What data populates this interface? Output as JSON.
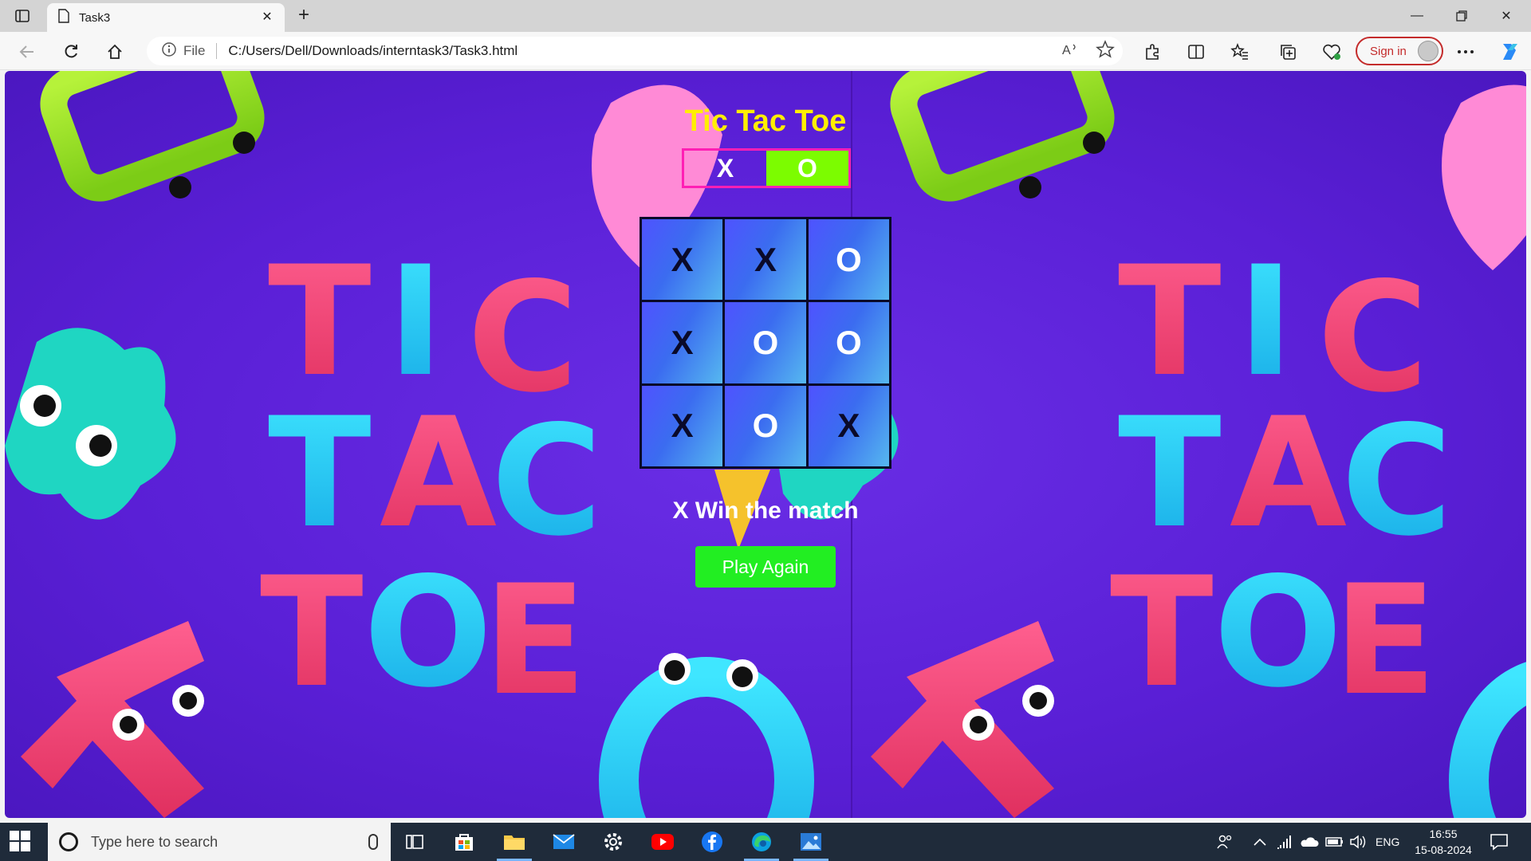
{
  "browser": {
    "tab_title": "Task3",
    "address_scheme": "File",
    "address_url": "C:/Users/Dell/Downloads/interntask3/Task3.html",
    "sign_in_label": "Sign in"
  },
  "game": {
    "title": "Tic Tac Toe",
    "turn_x": "X",
    "turn_o": "O",
    "active_turn": "O",
    "board": [
      "X",
      "X",
      "O",
      "X",
      "O",
      "O",
      "X",
      "O",
      "X"
    ],
    "result": "X Win the match",
    "play_again_label": "Play Again"
  },
  "colors": {
    "title": "#ffee00",
    "turn_border": "#ff1fb4",
    "active_turn_bg": "#7cfc00",
    "play_again_bg": "#22ee22",
    "background": "#5a1fd6"
  },
  "taskbar": {
    "search_placeholder": "Type here to search",
    "language": "ENG",
    "time": "16:55",
    "date": "15-08-2024",
    "apps": [
      "task-view-icon",
      "store-icon",
      "file-explorer-icon",
      "mail-icon",
      "settings-icon",
      "youtube-icon",
      "facebook-icon",
      "edge-icon",
      "photos-icon"
    ]
  }
}
